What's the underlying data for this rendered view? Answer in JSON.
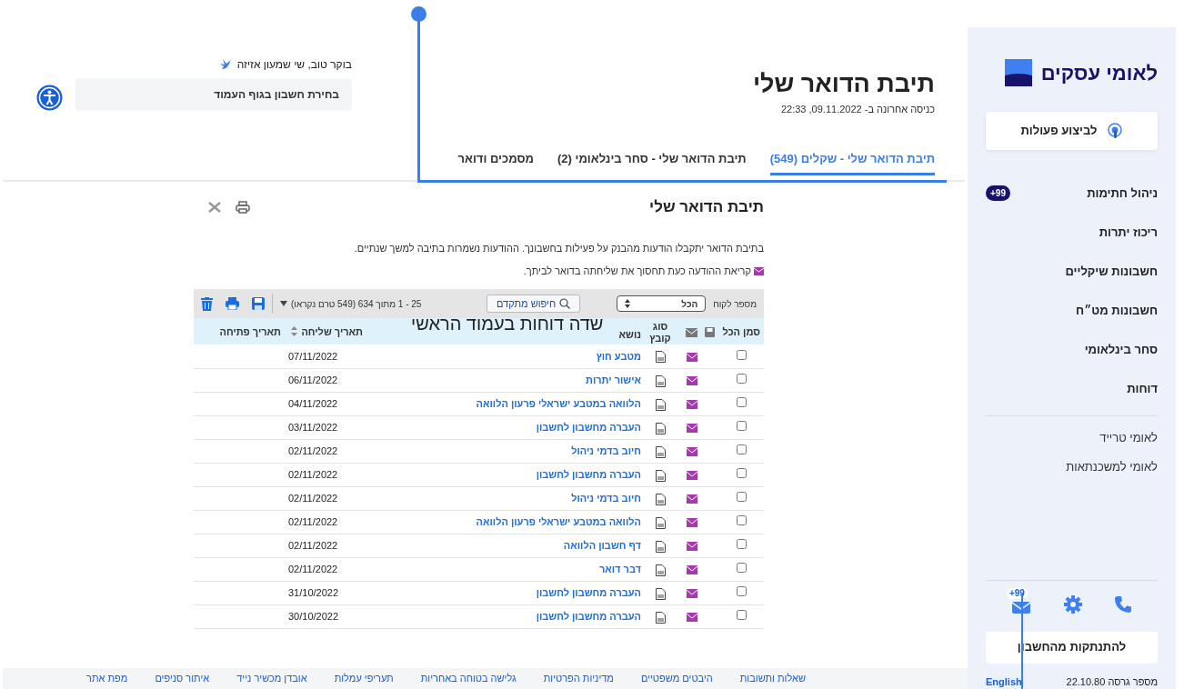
{
  "sidebar": {
    "logo": "לאומי עסקים",
    "action_button": "לביצוע פעולות",
    "nav_items": [
      {
        "label": "ניהול חתימות",
        "badge": "+99"
      },
      {
        "label": "ריכוז יתרות"
      },
      {
        "label": "חשבונות שיקליים"
      },
      {
        "label": "חשבונות מט״ח"
      },
      {
        "label": "סחר בינלאומי"
      },
      {
        "label": "דוחות"
      }
    ],
    "secondary_links": [
      "לאומי טרייד",
      "לאומי למשכנתאות"
    ],
    "mail_badge": "+99",
    "logout_button": "להתנתקות מהחשבון",
    "version": "מספר גרסה 22.10.80",
    "language_link": "English"
  },
  "header": {
    "title": "תיבת הדואר שלי",
    "last_login": "כניסה אחרונה ב- 09.11.2022, 22:33",
    "greeting": "בוקר טוב, שי שמעון אזיזה",
    "account_select": "בחירת חשבון בגוף העמוד"
  },
  "tabs": [
    {
      "label": "תיבת הדואר שלי - שקלים (549)",
      "selected": true
    },
    {
      "label": "תיבת הדואר שלי - סחר בינלאומי (2)",
      "selected": false
    },
    {
      "label": "מסמכים ודואר",
      "selected": false
    }
  ],
  "panel": {
    "title": "תיבת הדואר שלי",
    "intro": "בתיבת הדואר יתקבלו הודעות מהבנק על פעילות בחשבונך. ההודעות נשמרות בתיבה למשך שנתיים.",
    "notice": "קריאת ההודעה כעת תחסוך את שליחתה בדואר לביתך."
  },
  "toolbar": {
    "customer_label": "מספר לקוח",
    "customer_value": "הכל",
    "advanced_search": "חיפוש מתקדם",
    "paging": "25 - 1 מתוך 634 (549 טרם נקראו)"
  },
  "table": {
    "columns": [
      {
        "kind": "text",
        "label": "סמן הכל",
        "sortable": false
      },
      {
        "kind": "save"
      },
      {
        "kind": "mail"
      },
      {
        "kind": "text",
        "label": "סוג קובץ",
        "sortable": false
      },
      {
        "kind": "text",
        "label": "נושא",
        "sortable": false
      },
      {
        "kind": "text",
        "label": "תאריך שליחה",
        "sortable": true
      },
      {
        "kind": "text",
        "label": "תאריך פתיחה",
        "sortable": false
      }
    ],
    "rows": [
      {
        "checked": false,
        "subject": "מטבע חוץ",
        "sent": "07/11/2022"
      },
      {
        "checked": false,
        "subject": "אישור יתרות",
        "sent": "06/11/2022"
      },
      {
        "checked": false,
        "subject": "הלוואה במטבע ישראלי פרעון הלוואה",
        "sent": "04/11/2022"
      },
      {
        "checked": false,
        "subject": "העברה מחשבון לחשבון",
        "sent": "03/11/2022"
      },
      {
        "checked": false,
        "subject": "חיוב בדמי ניהול",
        "sent": "02/11/2022"
      },
      {
        "checked": false,
        "subject": "העברה מחשבון לחשבון",
        "sent": "02/11/2022"
      },
      {
        "checked": false,
        "subject": "חיוב בדמי ניהול",
        "sent": "02/11/2022"
      },
      {
        "checked": false,
        "subject": "הלוואה במטבע ישראלי פרעון הלוואה",
        "sent": "02/11/2022"
      },
      {
        "checked": false,
        "subject": "דף חשבון הלוואה",
        "sent": "02/11/2022"
      },
      {
        "checked": false,
        "subject": "דבר דואר",
        "sent": "02/11/2022"
      },
      {
        "checked": false,
        "subject": "העברה מחשבון לחשבון",
        "sent": "31/10/2022"
      },
      {
        "checked": false,
        "subject": "העברה מחשבון לחשבון",
        "sent": "30/10/2022"
      }
    ]
  },
  "footer_links": [
    "שאלות ותשובות",
    "היבטים משפטיים",
    "מדיניות הפרטיות",
    "גלישה בטוחה באחריות",
    "תעריפי עמלות",
    "אובדן מכשיר נייד",
    "איתור סניפים",
    "מפת אתר"
  ],
  "annotation": {
    "text": "שדה דוחות בעמוד הראשי"
  }
}
